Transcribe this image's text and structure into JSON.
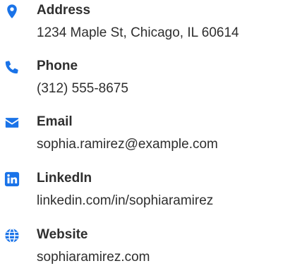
{
  "contact": {
    "accent_color": "#1a73e8",
    "items": [
      {
        "icon": "map-pin-icon",
        "label": "Address",
        "value": "1234 Maple St, Chicago, IL 60614"
      },
      {
        "icon": "phone-icon",
        "label": "Phone",
        "value": "(312) 555-8675"
      },
      {
        "icon": "envelope-icon",
        "label": "Email",
        "value": "sophia.ramirez@example.com"
      },
      {
        "icon": "linkedin-icon",
        "label": "LinkedIn",
        "value": "linkedin.com/in/sophiaramirez"
      },
      {
        "icon": "globe-icon",
        "label": "Website",
        "value": "sophiaramirez.com"
      }
    ]
  }
}
